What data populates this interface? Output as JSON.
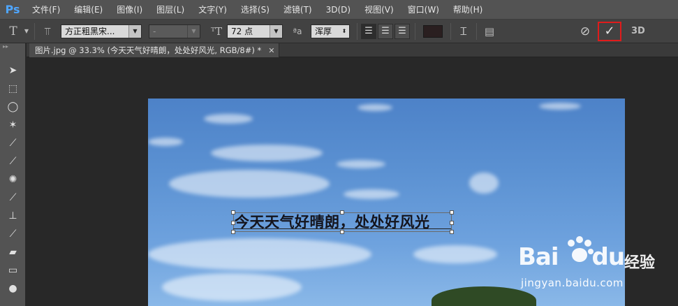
{
  "app": {
    "logo": "Ps"
  },
  "menu": [
    "文件(F)",
    "编辑(E)",
    "图像(I)",
    "图层(L)",
    "文字(Y)",
    "选择(S)",
    "滤镜(T)",
    "3D(D)",
    "视图(V)",
    "窗口(W)",
    "帮助(H)"
  ],
  "options": {
    "font_family": "方正粗黑宋...",
    "font_style": "-",
    "font_size": "72 点",
    "aa_label": "ªa",
    "antialias": "浑厚",
    "text_color": "#2a1f20",
    "three_d": "3D"
  },
  "document": {
    "tab_title": "图片.jpg @ 33.3% (今天天气好晴朗，处处好风光, RGB/8#) *",
    "text_layer": "今天天气好晴朗，处处好风光"
  },
  "watermark": {
    "brand": "Bai",
    "brand_du": "du",
    "cn": "经验",
    "url": "jingyan.baidu.com"
  }
}
